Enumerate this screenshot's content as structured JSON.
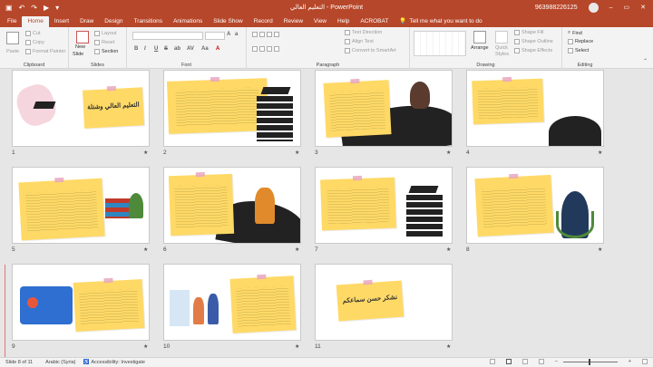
{
  "window": {
    "title": "التعليم العالي  -  PowerPoint",
    "user": "963988226125",
    "minimize": "–",
    "restore": "▭",
    "close": "✕",
    "save_glyph": "▣",
    "undo_glyph": "↶",
    "redo_glyph": "↷",
    "present_glyph": "▶",
    "customize_glyph": "▾"
  },
  "tabs": [
    "File",
    "Home",
    "Insert",
    "Draw",
    "Design",
    "Transitions",
    "Animations",
    "Slide Show",
    "Record",
    "Review",
    "View",
    "Help",
    "ACROBAT"
  ],
  "tell_me": "Tell me what you want to do",
  "ribbon": {
    "clipboard": {
      "label": "Clipboard",
      "paste": "Paste",
      "cut": "Cut",
      "copy": "Copy",
      "format_painter": "Format Painter"
    },
    "slides": {
      "label": "Slides",
      "new_slide": "New",
      "new_slide_2": "Slide",
      "layout": "Layout",
      "reset": "Reset",
      "section": "Section"
    },
    "font": {
      "label": "Font",
      "bold": "B",
      "italic": "I",
      "underline": "U",
      "strike": "S",
      "shadow": "ab",
      "spacing": "AV",
      "case": "Aa",
      "color": "A"
    },
    "paragraph": {
      "label": "Paragraph",
      "text_direction": "Text Direction",
      "align_text": "Align Text",
      "convert": "Convert to SmartArt"
    },
    "drawing": {
      "label": "Drawing",
      "arrange": "Arrange",
      "quick_styles": "Quick",
      "quick_styles_2": "Styles",
      "shape_fill": "Shape Fill",
      "shape_outline": "Shape Outline",
      "shape_effects": "Shape Effects"
    },
    "editing": {
      "label": "Editing",
      "find": "Find",
      "replace": "Replace",
      "select": "Select"
    }
  },
  "slides": [
    {
      "num": "1",
      "text": "التعليم العالي وشتلة"
    },
    {
      "num": "2"
    },
    {
      "num": "3"
    },
    {
      "num": "4"
    },
    {
      "num": "5"
    },
    {
      "num": "6"
    },
    {
      "num": "7"
    },
    {
      "num": "8"
    },
    {
      "num": "9"
    },
    {
      "num": "10"
    },
    {
      "num": "11",
      "text": "نشكر حسن سماعكم"
    }
  ],
  "star": "★",
  "status": {
    "slide": "Slide 8 of 11",
    "language": "Arabic (Syria)",
    "accessibility": "Accessibility: Investigate",
    "zoom_minus": "–",
    "zoom_plus": "+"
  }
}
